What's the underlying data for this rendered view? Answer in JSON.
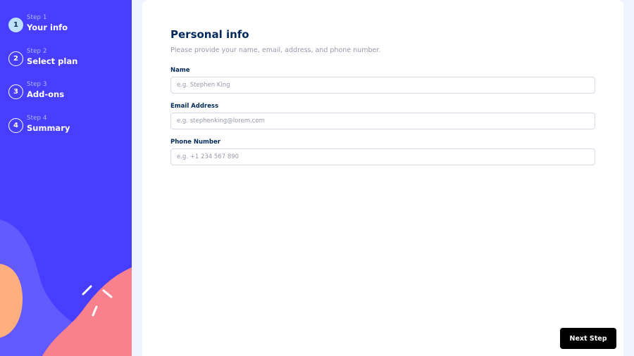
{
  "sidebar": {
    "steps": [
      {
        "number": "1",
        "caption": "Step 1",
        "title": "Your info",
        "active": true
      },
      {
        "number": "2",
        "caption": "Step 2",
        "title": "Select plan",
        "active": false
      },
      {
        "number": "3",
        "caption": "Step 3",
        "title": "Add-ons",
        "active": false
      },
      {
        "number": "4",
        "caption": "Step 4",
        "title": "Summary",
        "active": false
      }
    ]
  },
  "form": {
    "title": "Personal info",
    "subtitle": "Please provide your name, email, address, and phone number.",
    "fields": [
      {
        "label": "Name",
        "placeholder": "e.g. Stephen King",
        "value": ""
      },
      {
        "label": "Email Address",
        "placeholder": "e.g. stephenking@lorem.com",
        "value": ""
      },
      {
        "label": "Phone Number",
        "placeholder": "e.g. +1 234 567 890",
        "value": ""
      }
    ],
    "next_label": "Next Step"
  },
  "colors": {
    "sidebar_bg": "#483eff",
    "active_step": "#bee2fd",
    "title": "#02295a",
    "muted": "#9699ab",
    "border": "#d6d9e6",
    "button": "#000000",
    "blob_orange": "#ffaf7e",
    "blob_pink": "#f9818e",
    "blob_purple": "#6259ff"
  }
}
